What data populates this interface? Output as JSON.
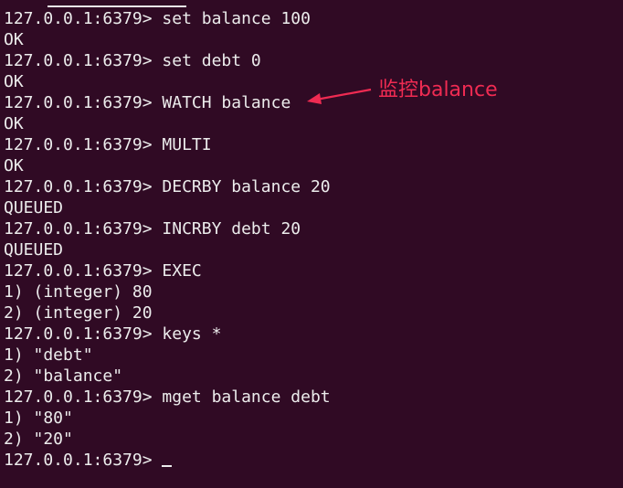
{
  "terminal": {
    "lines": [
      {
        "prompt": "127.0.0.1:6379>",
        "text": " set balance 100"
      },
      {
        "prompt": "",
        "text": "OK"
      },
      {
        "prompt": "127.0.0.1:6379>",
        "text": " set debt 0"
      },
      {
        "prompt": "",
        "text": "OK"
      },
      {
        "prompt": "127.0.0.1:6379>",
        "text": " WATCH balance"
      },
      {
        "prompt": "",
        "text": "OK"
      },
      {
        "prompt": "127.0.0.1:6379>",
        "text": " MULTI"
      },
      {
        "prompt": "",
        "text": "OK"
      },
      {
        "prompt": "127.0.0.1:6379>",
        "text": " DECRBY balance 20"
      },
      {
        "prompt": "",
        "text": "QUEUED"
      },
      {
        "prompt": "127.0.0.1:6379>",
        "text": " INCRBY debt 20"
      },
      {
        "prompt": "",
        "text": "QUEUED"
      },
      {
        "prompt": "127.0.0.1:6379>",
        "text": " EXEC"
      },
      {
        "prompt": "",
        "text": "1) (integer) 80"
      },
      {
        "prompt": "",
        "text": "2) (integer) 20"
      },
      {
        "prompt": "127.0.0.1:6379>",
        "text": " keys *"
      },
      {
        "prompt": "",
        "text": "1) \"debt\""
      },
      {
        "prompt": "",
        "text": "2) \"balance\""
      },
      {
        "prompt": "127.0.0.1:6379>",
        "text": " mget balance debt"
      },
      {
        "prompt": "",
        "text": "1) \"80\""
      },
      {
        "prompt": "",
        "text": "2) \"20\""
      },
      {
        "prompt": "127.0.0.1:6379>",
        "text": " "
      }
    ]
  },
  "annotation": {
    "text": "监控balance",
    "color": "#ef2b52"
  },
  "colors": {
    "background": "#300a24",
    "foreground": "#ececec"
  }
}
